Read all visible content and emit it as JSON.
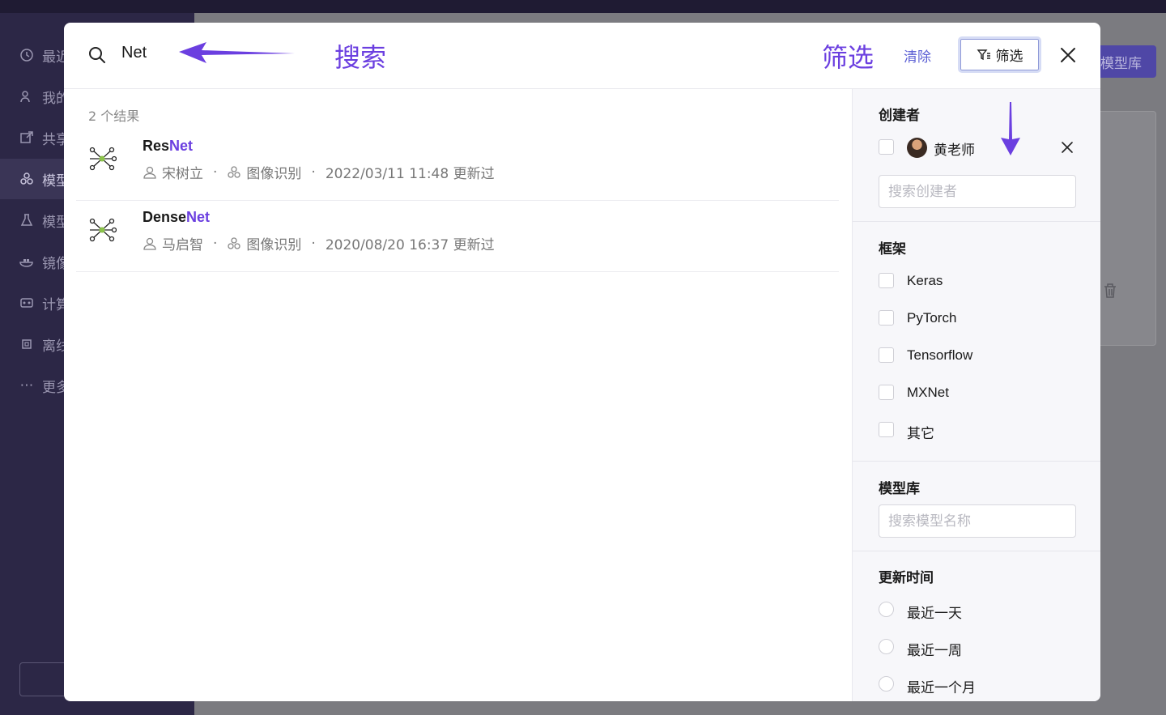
{
  "background": {
    "sidebar_items": [
      {
        "icon": "clock-icon",
        "label": "最近"
      },
      {
        "icon": "user-icon",
        "label": "我的"
      },
      {
        "icon": "share-icon",
        "label": "共享"
      },
      {
        "icon": "model-icon",
        "label": "模型"
      },
      {
        "icon": "flask-icon",
        "label": "模型"
      },
      {
        "icon": "docker-icon",
        "label": "镜像"
      },
      {
        "icon": "compute-icon",
        "label": "计算"
      },
      {
        "icon": "chip-icon",
        "label": "离线"
      },
      {
        "icon": "more-icon",
        "label": "更多"
      }
    ],
    "primary_button": "模型库"
  },
  "header": {
    "search_value": "Net",
    "annotation_search": "搜索",
    "annotation_filter": "筛选",
    "clear_label": "清除",
    "filter_button_label": "筛选"
  },
  "results": {
    "count_label": "2 个结果",
    "items": [
      {
        "title_prefix": "Res",
        "title_match": "Net",
        "author": "宋树立",
        "category": "图像识别",
        "updated": "2022/03/11 11:48 更新过"
      },
      {
        "title_prefix": "Dense",
        "title_match": "Net",
        "author": "马启智",
        "category": "图像识别",
        "updated": "2020/08/20 16:37 更新过"
      }
    ]
  },
  "filters": {
    "creator": {
      "title": "创建者",
      "selected_name": "黄老师",
      "search_placeholder": "搜索创建者"
    },
    "framework": {
      "title": "框架",
      "options": [
        "Keras",
        "PyTorch",
        "Tensorflow",
        "MXNet",
        "其它"
      ]
    },
    "model_repo": {
      "title": "模型库",
      "search_placeholder": "搜索模型名称"
    },
    "updated_time": {
      "title": "更新时间",
      "options": [
        "最近一天",
        "最近一周",
        "最近一个月"
      ]
    }
  },
  "colors": {
    "accent": "#6b3fe0",
    "link": "#5b5fd4"
  }
}
